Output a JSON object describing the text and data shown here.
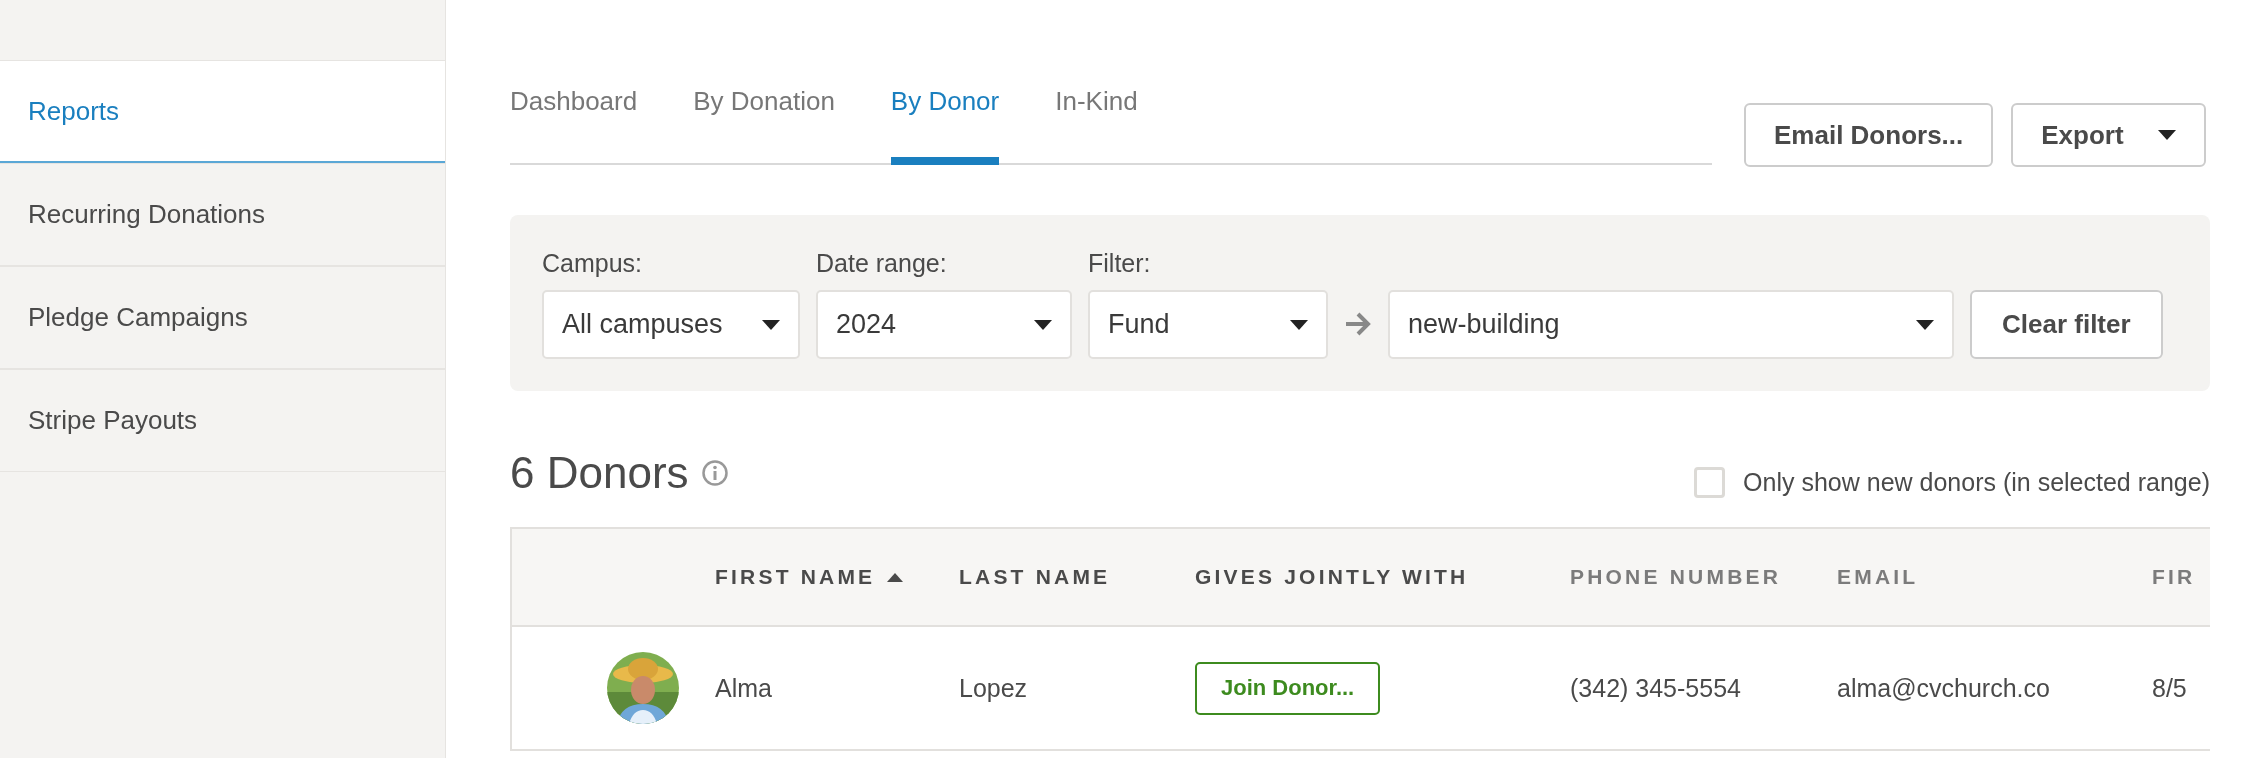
{
  "sidebar": {
    "items": [
      {
        "label": "Reports",
        "selected": true
      },
      {
        "label": "Recurring Donations",
        "selected": false
      },
      {
        "label": "Pledge Campaigns",
        "selected": false
      },
      {
        "label": "Stripe Payouts",
        "selected": false
      }
    ]
  },
  "tabs": [
    {
      "label": "Dashboard",
      "selected": false
    },
    {
      "label": "By Donation",
      "selected": false
    },
    {
      "label": "By Donor",
      "selected": true
    },
    {
      "label": "In-Kind",
      "selected": false
    }
  ],
  "actions": [
    {
      "label": "Email Donors...",
      "kind": "button"
    },
    {
      "label": "Export",
      "kind": "menu"
    }
  ],
  "filters": {
    "campus": {
      "label": "Campus:",
      "value": "All campuses"
    },
    "date_range": {
      "label": "Date range:",
      "value": "2024"
    },
    "filter": {
      "label": "Filter:",
      "value": "Fund"
    },
    "fund": {
      "value": "new-building"
    },
    "clear_button": "Clear filter"
  },
  "summary": {
    "title": "6 Donors",
    "new_donors_only": {
      "label": "Only show new donors (in selected range)",
      "checked": false
    }
  },
  "table": {
    "columns": [
      {
        "label": "FIRST NAME",
        "sortable": true,
        "sorted": true
      },
      {
        "label": "LAST NAME",
        "sortable": true,
        "sorted": false
      },
      {
        "label": "GIVES JOINTLY WITH",
        "sortable": true,
        "sorted": false
      },
      {
        "label": "PHONE NUMBER",
        "sortable": false,
        "sorted": false
      },
      {
        "label": "EMAIL",
        "sortable": false,
        "sorted": false
      },
      {
        "label": "FIR"
      }
    ],
    "rows": [
      {
        "first_name": "Alma",
        "last_name": "Lopez",
        "joint_action": "Join Donor...",
        "phone": "(342) 345-5554",
        "email": "alma@cvchurch.co",
        "column_6": "8/5"
      }
    ]
  }
}
